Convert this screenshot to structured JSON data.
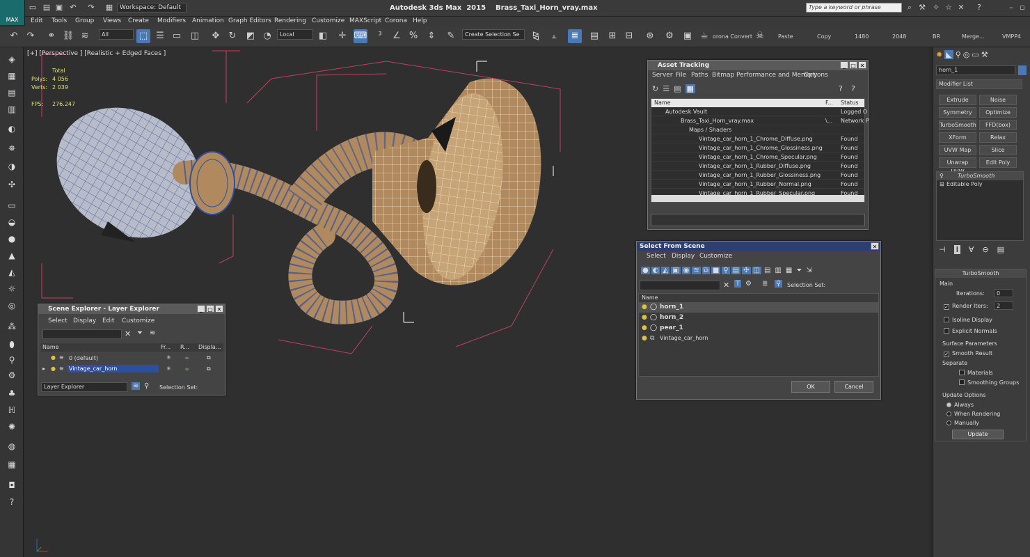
{
  "app": {
    "title": "Autodesk 3ds Max  2015    Brass_Taxi_Horn_vray.max",
    "logo": "MAX",
    "workspace": "Workspace: Default",
    "search_placeholder": "Type a keyword or phrase"
  },
  "menu": [
    "Edit",
    "Tools",
    "Group",
    "Views",
    "Create",
    "Modifiers",
    "Animation",
    "Graph Editors",
    "Rendering",
    "Customize",
    "MAXScript",
    "Corona",
    "Help"
  ],
  "toolbar": {
    "filter": "All",
    "coord": "Local",
    "selection_set": "Create Selection Se",
    "corona_convert": "orona Convert",
    "labels": [
      "Paste",
      "Copy",
      "1480",
      "2048",
      "BR",
      "Merge...",
      "VMPP4"
    ]
  },
  "viewport": {
    "label": "[+] [Perspective ] [Realistic + Edged Faces ]",
    "stats": {
      "total_label": "Total",
      "polys_label": "Polys:",
      "polys": "4 056",
      "verts_label": "Verts:",
      "verts": "2 039",
      "fps_label": "FPS:",
      "fps": "276.247"
    }
  },
  "asset_tracking": {
    "title": "Asset Tracking",
    "menu": [
      "Server",
      "File",
      "Paths",
      "Bitmap Performance and Memory",
      "Options"
    ],
    "columns": [
      "Name",
      "F...",
      "Status"
    ],
    "rows": [
      {
        "name": "Autodesk Vault",
        "f": "",
        "status": "Logged O"
      },
      {
        "name": "Brass_Taxi_Horn_vray.max",
        "f": "\\...",
        "status": "Network P"
      },
      {
        "name": "Maps / Shaders",
        "f": "",
        "status": ""
      },
      {
        "name": "Vintage_car_horn_1_Chrome_Diffuse.png",
        "f": "",
        "status": "Found"
      },
      {
        "name": "Vintage_car_horn_1_Chrome_Glossiness.png",
        "f": "",
        "status": "Found"
      },
      {
        "name": "Vintage_car_horn_1_Chrome_Specular.png",
        "f": "",
        "status": "Found"
      },
      {
        "name": "Vintage_car_horn_1_Rubber_Diffuse.png",
        "f": "",
        "status": "Found"
      },
      {
        "name": "Vintage_car_horn_1_Rubber_Glossiness.png",
        "f": "",
        "status": "Found"
      },
      {
        "name": "Vintage_car_horn_1_Rubber_Normal.png",
        "f": "",
        "status": "Found"
      },
      {
        "name": "Vintage_car_horn_1_Rubber_Specular.png",
        "f": "",
        "status": "Found"
      }
    ]
  },
  "select_from_scene": {
    "title": "Select From Scene",
    "menu": [
      "Select",
      "Display",
      "Customize"
    ],
    "selection_set_label": "Selection Set:",
    "column": "Name",
    "rows": [
      "horn_1",
      "horn_2",
      "pear_1",
      "Vintage_car_horn"
    ],
    "ok": "OK",
    "cancel": "Cancel"
  },
  "scene_explorer": {
    "title": "Scene Explorer - Layer Explorer",
    "menu": [
      "Select",
      "Display",
      "Edit",
      "Customize"
    ],
    "columns": [
      "Name",
      "Fr...",
      "R...",
      "Displa..."
    ],
    "rows": [
      "0 (default)",
      "Vintage_car_horn"
    ],
    "footer_dropdown": "Layer Explorer",
    "selection_set_label": "Selection Set:"
  },
  "command_panel": {
    "object_name": "horn_1",
    "modifier_list": "Modifier List",
    "buttons": [
      "Extrude",
      "Noise",
      "Symmetry",
      "Optimize",
      "TurboSmooth",
      "FFD(box)",
      "XForm",
      "Relax",
      "UVW Map",
      "Slice",
      "Unwrap UVW",
      "Edit Poly"
    ],
    "stack": [
      "TurboSmooth",
      "Editable Poly"
    ],
    "rollout_title": "TurboSmooth",
    "main_label": "Main",
    "iterations_label": "Iterations:",
    "iterations": "0",
    "render_iters_label": "Render Iters:",
    "render_iters": "2",
    "isoline": "Isoline Display",
    "explicit": "Explicit Normals",
    "surface_params": "Surface Parameters",
    "smooth_result": "Smooth Result",
    "separate": "Separate",
    "materials": "Materials",
    "smoothing_groups": "Smoothing Groups",
    "update_options": "Update Options",
    "always": "Always",
    "when_rendering": "When Rendering",
    "manually": "Manually",
    "update": "Update"
  },
  "colors": {
    "accent": "#4a79b5",
    "horn_wood": "#b08a5e",
    "bulb": "#b8bcc8",
    "wire": "#2f4fa0"
  }
}
